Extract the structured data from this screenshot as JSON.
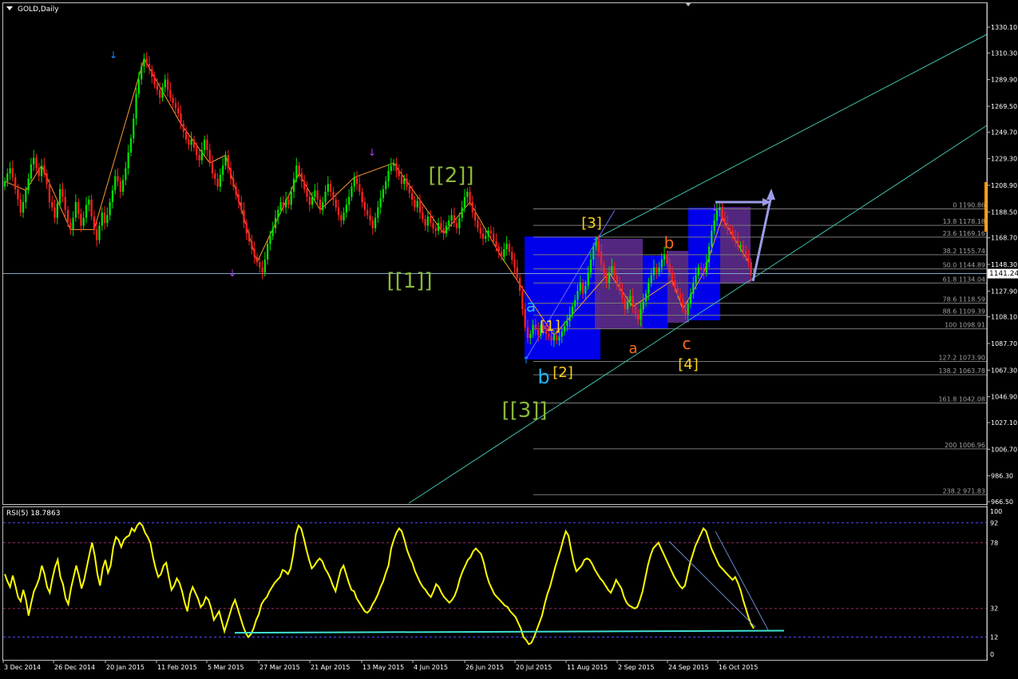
{
  "header": {
    "symbol_label": "GOLD,Daily",
    "rsi_label": "RSI(5) 18.7863"
  },
  "colors": {
    "background": "#000000",
    "axis": "#c0c0c0",
    "bull": "#00e000",
    "bear": "#ff2020",
    "zigzag": "#ff9a30",
    "channel": "#40c0b0",
    "fib": "#7a7a7a",
    "rsi_line": "#ffff00",
    "rsi_level": "#9a2a6a",
    "rsi_trend": "#40e0d0",
    "box_blue": "#0000ff",
    "box_purple": "#5a2a8a",
    "label_green": "#8ab83a",
    "label_yellow": "#ffd21a",
    "label_cyan": "#1ab8ff",
    "label_orange": "#ff6a1a",
    "price_marker": "#ffffff"
  },
  "current_price": "1141.24",
  "chart_data": [
    {
      "type": "line",
      "title": "GOLD,Daily",
      "ylim": [
        960,
        1340
      ],
      "y_ticks": [
        "1330.10",
        "1310.30",
        "1289.90",
        "1269.50",
        "1249.70",
        "1229.30",
        "1208.90",
        "1188.50",
        "1168.70",
        "1148.30",
        "1127.90",
        "1108.10",
        "1087.70",
        "1067.30",
        "1046.90",
        "1027.10",
        "1006.70",
        "986.30",
        "966.50"
      ],
      "y_tick_values": [
        1330.1,
        1310.3,
        1289.9,
        1269.5,
        1249.7,
        1229.3,
        1208.9,
        1188.5,
        1168.7,
        1148.3,
        1127.9,
        1108.1,
        1087.7,
        1067.3,
        1046.9,
        1027.1,
        1006.7,
        986.3,
        966.5
      ],
      "x_ticks": [
        "3 Dec 2014",
        "26 Dec 2014",
        "20 Jan 2015",
        "11 Feb 2015",
        "5 Mar 2015",
        "27 Mar 2015",
        "21 Apr 2015",
        "13 May 2015",
        "4 Jun 2015",
        "26 Jun 2015",
        "20 Jul 2015",
        "11 Aug 2015",
        "2 Sep 2015",
        "24 Sep 2015",
        "16 Oct 2015"
      ],
      "series": [
        {
          "close_by_bar": [
            1212,
            1218,
            1222,
            1215,
            1206,
            1198,
            1188,
            1196,
            1205,
            1214,
            1225,
            1230,
            1222,
            1216,
            1224,
            1218,
            1210,
            1196,
            1192,
            1184,
            1195,
            1206,
            1200,
            1190,
            1180,
            1175,
            1184,
            1196,
            1187,
            1178,
            1184,
            1194,
            1198,
            1185,
            1175,
            1167,
            1178,
            1188,
            1180,
            1186,
            1196,
            1205,
            1216,
            1212,
            1204,
            1213,
            1222,
            1234,
            1245,
            1260,
            1279,
            1290,
            1300,
            1306,
            1302,
            1298,
            1292,
            1286,
            1282,
            1276,
            1284,
            1290,
            1282,
            1276,
            1272,
            1268,
            1264,
            1256,
            1250,
            1244,
            1240,
            1244,
            1238,
            1232,
            1228,
            1236,
            1244,
            1236,
            1226,
            1218,
            1214,
            1208,
            1217,
            1224,
            1232,
            1222,
            1214,
            1208,
            1202,
            1196,
            1190,
            1180,
            1172,
            1166,
            1160,
            1154,
            1150,
            1146,
            1142,
            1152,
            1164,
            1170,
            1176,
            1184,
            1190,
            1196,
            1192,
            1198,
            1194,
            1204,
            1214,
            1224,
            1218,
            1212,
            1206,
            1200,
            1194,
            1200,
            1205,
            1198,
            1190,
            1196,
            1204,
            1210,
            1204,
            1198,
            1192,
            1186,
            1182,
            1188,
            1194,
            1200,
            1208,
            1215,
            1210,
            1204,
            1196,
            1190,
            1186,
            1182,
            1176,
            1184,
            1192,
            1199,
            1206,
            1212,
            1220,
            1224,
            1226,
            1220,
            1216,
            1210,
            1214,
            1208,
            1203,
            1198,
            1192,
            1197,
            1188,
            1183,
            1178,
            1185,
            1180,
            1176,
            1174,
            1180,
            1176,
            1172,
            1178,
            1182,
            1186,
            1180,
            1176,
            1184,
            1192,
            1200,
            1204,
            1196,
            1188,
            1182,
            1176,
            1172,
            1168,
            1170,
            1174,
            1172,
            1166,
            1162,
            1158,
            1154,
            1160,
            1164,
            1158,
            1152,
            1146,
            1138,
            1128,
            1114,
            1100,
            1092,
            1095,
            1102,
            1098,
            1094,
            1102,
            1098,
            1095,
            1093,
            1090,
            1094,
            1090,
            1093,
            1097,
            1101,
            1105,
            1110,
            1116,
            1121,
            1128,
            1134,
            1126,
            1132,
            1142,
            1152,
            1162,
            1166,
            1158,
            1148,
            1140,
            1134,
            1142,
            1147,
            1140,
            1134,
            1128,
            1122,
            1114,
            1120,
            1124,
            1116,
            1110,
            1106,
            1114,
            1120,
            1126,
            1134,
            1140,
            1146,
            1142,
            1146,
            1152,
            1156,
            1149,
            1142,
            1136,
            1130,
            1126,
            1122,
            1114,
            1110,
            1118,
            1126,
            1134,
            1140,
            1146,
            1144,
            1142,
            1150,
            1162,
            1174,
            1182,
            1190,
            1192,
            1184,
            1180,
            1176,
            1174,
            1170,
            1167,
            1162,
            1163,
            1158,
            1154,
            1150,
            1140,
            1141
          ]
        }
      ],
      "wave_labels": [
        "[[1]]",
        "[[2]]",
        "[[3]]",
        "[1]",
        "[2]",
        "[3]",
        "[4]",
        "a",
        "b",
        "a",
        "b",
        "c"
      ],
      "fib_levels": [
        "0 1190.86",
        "13.8 1178.18",
        "23.6 1169.16",
        "38.2 1155.74",
        "50.0 1144.89",
        "61.8 1134.04",
        "78.6 1118.59",
        "88.6 1109.39",
        "100 1098.91",
        "127.2 1073.90",
        "138.2 1063.78",
        "161.8 1042.08",
        "200 1006.96",
        "238.2 971.83"
      ],
      "fib_values": [
        1190.86,
        1178.18,
        1169.16,
        1155.74,
        1144.89,
        1134.04,
        1118.59,
        1109.39,
        1098.91,
        1073.9,
        1063.78,
        1042.08,
        1006.96,
        971.83
      ],
      "grid": false
    },
    {
      "type": "line",
      "title": "RSI(5) 18.7863",
      "ylim": [
        0,
        100
      ],
      "y_ticks": [
        "100",
        "92",
        "78",
        "32",
        "12",
        "0"
      ],
      "levels": [
        92,
        78,
        32,
        12
      ],
      "series": [
        {
          "values": [
            56,
            51,
            47,
            55,
            48,
            40,
            37,
            45,
            38,
            27,
            36,
            44,
            48,
            53,
            62,
            56,
            47,
            43,
            53,
            61,
            66,
            54,
            49,
            39,
            35,
            46,
            54,
            62,
            55,
            46,
            52,
            61,
            70,
            78,
            69,
            56,
            48,
            60,
            66,
            57,
            62,
            75,
            82,
            80,
            75,
            80,
            82,
            83,
            88,
            86,
            90,
            92,
            90,
            85,
            82,
            78,
            68,
            60,
            54,
            56,
            62,
            64,
            54,
            45,
            48,
            53,
            50,
            44,
            36,
            30,
            42,
            47,
            43,
            39,
            33,
            35,
            40,
            38,
            32,
            24,
            27,
            30,
            23,
            16,
            22,
            28,
            34,
            38,
            32,
            26,
            20,
            15,
            12,
            14,
            18,
            24,
            28,
            35,
            38,
            40,
            44,
            47,
            50,
            52,
            54,
            59,
            58,
            56,
            60,
            70,
            84,
            90,
            88,
            81,
            73,
            66,
            60,
            62,
            65,
            67,
            65,
            60,
            57,
            53,
            48,
            44,
            52,
            59,
            62,
            56,
            50,
            45,
            44,
            39,
            36,
            33,
            30,
            29,
            31,
            35,
            38,
            42,
            47,
            51,
            57,
            62,
            74,
            80,
            85,
            88,
            86,
            80,
            73,
            68,
            64,
            58,
            54,
            50,
            47,
            45,
            42,
            40,
            44,
            49,
            47,
            43,
            40,
            38,
            36,
            38,
            41,
            46,
            53,
            58,
            62,
            66,
            68,
            72,
            74,
            72,
            70,
            64,
            56,
            50,
            46,
            42,
            40,
            38,
            36,
            34,
            33,
            30,
            28,
            26,
            22,
            18,
            12,
            10,
            7,
            8,
            12,
            17,
            22,
            27,
            35,
            42,
            47,
            54,
            61,
            67,
            73,
            80,
            86,
            83,
            73,
            64,
            58,
            60,
            62,
            66,
            67,
            66,
            63,
            59,
            56,
            53,
            51,
            48,
            45,
            43,
            47,
            52,
            49,
            46,
            40,
            36,
            34,
            33,
            32,
            33,
            38,
            44,
            53,
            62,
            69,
            74,
            76,
            78,
            74,
            70,
            66,
            62,
            58,
            54,
            51,
            48,
            46,
            48,
            56,
            64,
            70,
            76,
            80,
            84,
            88,
            86,
            80,
            74,
            70,
            66,
            62,
            60,
            58,
            56,
            54,
            52,
            54,
            50,
            45,
            38,
            32,
            26,
            21,
            18
          ]
        }
      ],
      "grid": false
    }
  ]
}
